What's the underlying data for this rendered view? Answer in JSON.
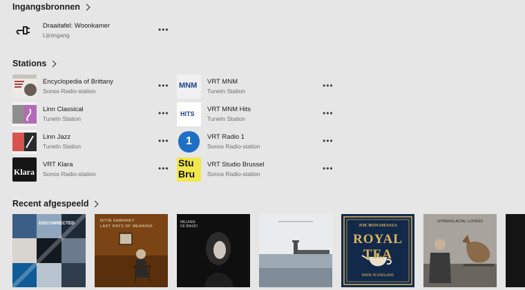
{
  "sections": {
    "inputs_title": "Ingangsbronnen",
    "stations_title": "Stations",
    "recent_title": "Recent afgespeeld"
  },
  "inputs": [
    {
      "title": "Draaitafel: Woonkamer",
      "subtitle": "Lijningang",
      "icon": "line-in-plug-icon"
    }
  ],
  "stations_left": [
    {
      "title": "Encyclopedia of Brittany",
      "subtitle": "Sonos Radio-station"
    },
    {
      "title": "Linn Classical",
      "subtitle": "TuneIn Station"
    },
    {
      "title": "Linn Jazz",
      "subtitle": "TuneIn Station"
    },
    {
      "title": "VRT Klara",
      "subtitle": "Sonos Radio-station",
      "logo_text": "Klara"
    }
  ],
  "stations_right": [
    {
      "title": "VRT MNM",
      "subtitle": "TuneIn Station",
      "logo_text": "MNM"
    },
    {
      "title": "VRT MNM Hits",
      "subtitle": "TuneIn Station",
      "logo_text": "HITS"
    },
    {
      "title": "VRT Radio 1",
      "subtitle": "Sonos Radio-station",
      "logo_text": "1"
    },
    {
      "title": "VRT Studio Brussel",
      "subtitle": "Sonos Radio-station",
      "logo_text_top": "Stu",
      "logo_text_bottom": "Bru"
    }
  ],
  "more_label": "•••",
  "recent_albums": [
    {
      "name": "album-collage",
      "text": "DISCONNECTED"
    },
    {
      "name": "album-nitin-sawhney",
      "artist": "NITIN SAWHNEY",
      "title": "LAST DAYS OF MEANING"
    },
    {
      "name": "album-melanie-de-biasio",
      "text": "MELANIE DE BIASIO"
    },
    {
      "name": "album-pier-lighthouse"
    },
    {
      "name": "album-royal-tea",
      "artist": "JOE BONAMASSA",
      "title": "ROYAL TEA",
      "footer": "MADE IN ENGLAND"
    },
    {
      "name": "album-hyperglacial-lovers",
      "text": "HYPERGLACIAL LOVERS"
    },
    {
      "name": "album-partial"
    }
  ],
  "colors": {
    "background": "#e6e6e6",
    "text": "#1f1f1f",
    "secondary": "#6d6d6d",
    "royal_tea_gold": "#d9b45b",
    "royal_tea_navy": "#12294a",
    "radio1_blue": "#1f6fc4",
    "stubru_yellow": "#f3e84a"
  }
}
